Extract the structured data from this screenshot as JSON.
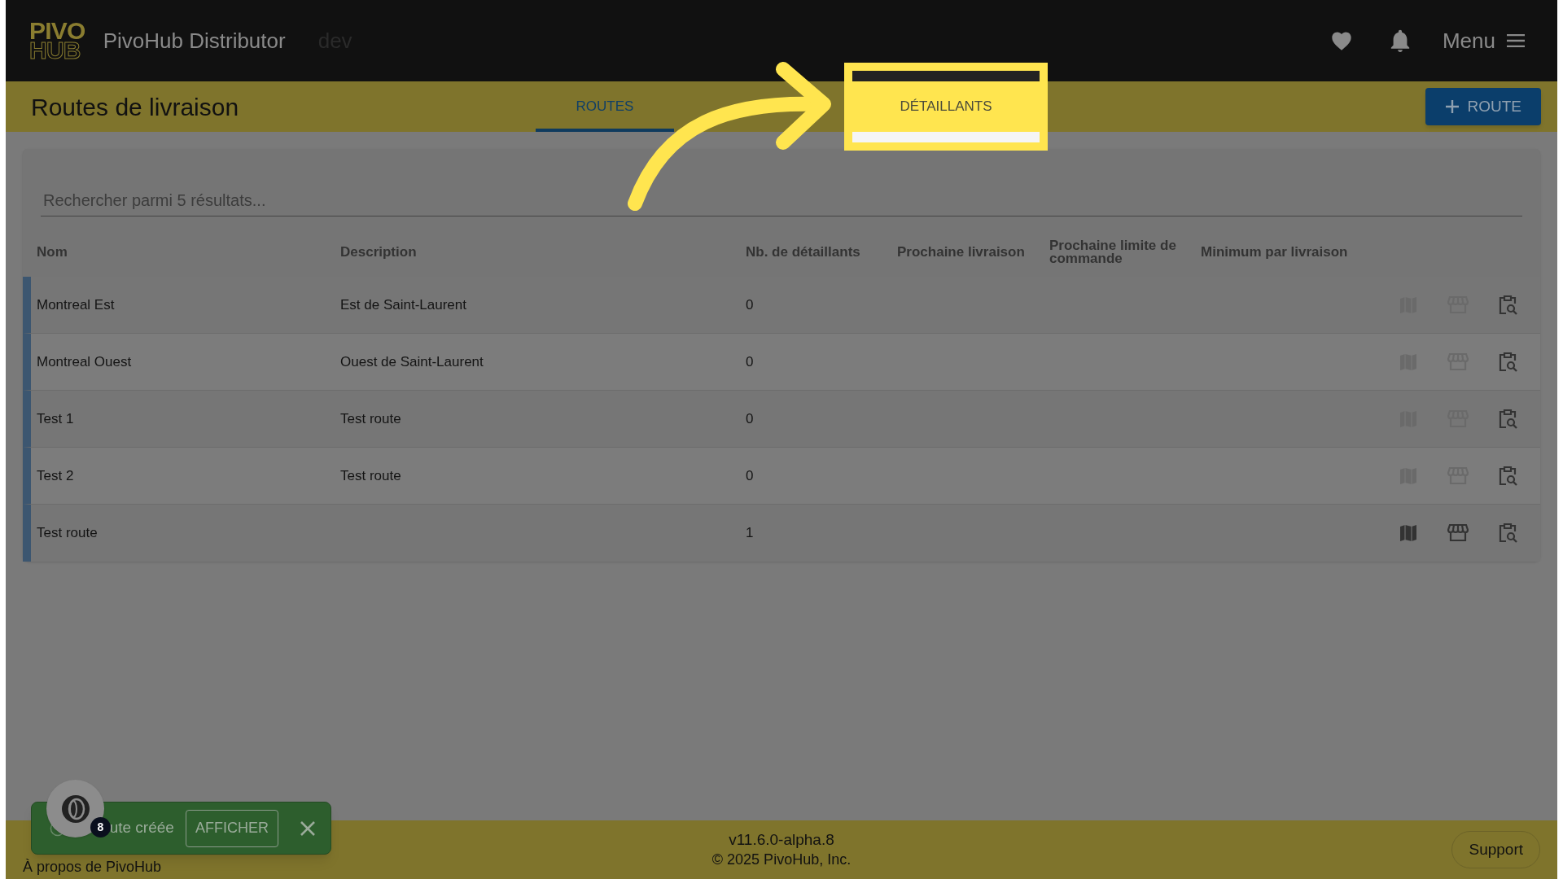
{
  "header": {
    "logo_lines": [
      "PIVO",
      "HUB"
    ],
    "app_name": "PivoHub Distributor",
    "environment": "dev",
    "menu_label": "Menu"
  },
  "page": {
    "title": "Routes de livraison",
    "add_button": "ROUTE",
    "tabs": [
      {
        "label": "ROUTES",
        "selected": true,
        "highlighted": false
      },
      {
        "label": "DÉTAILLANTS",
        "selected": false,
        "highlighted": true
      }
    ]
  },
  "search": {
    "placeholder": "Rechercher parmi 5 résultats..."
  },
  "table": {
    "columns": [
      "Nom",
      "Description",
      "Nb. de détaillants",
      "Prochaine livraison",
      "Prochaine limite de commande",
      "Minimum par livraison"
    ],
    "rows": [
      {
        "name": "Montreal Est",
        "description": "Est de Saint-Laurent",
        "retailer_count": "0",
        "actions_enabled": false
      },
      {
        "name": "Montreal Ouest",
        "description": "Ouest de Saint-Laurent",
        "retailer_count": "0",
        "actions_enabled": false
      },
      {
        "name": "Test 1",
        "description": "Test route",
        "retailer_count": "0",
        "actions_enabled": false
      },
      {
        "name": "Test 2",
        "description": "Test route",
        "retailer_count": "0",
        "actions_enabled": false
      },
      {
        "name": "Test route",
        "retailer_count": "1",
        "actions_enabled": true
      }
    ]
  },
  "toast": {
    "message": "ute créée",
    "action": "AFFICHER"
  },
  "avatar_badge": "8",
  "footer": {
    "about_link": "À propos de PivoHub",
    "version": "v11.6.0-alpha.8",
    "copyright": "© 2025 PivoHub, Inc.",
    "support_button": "Support"
  }
}
